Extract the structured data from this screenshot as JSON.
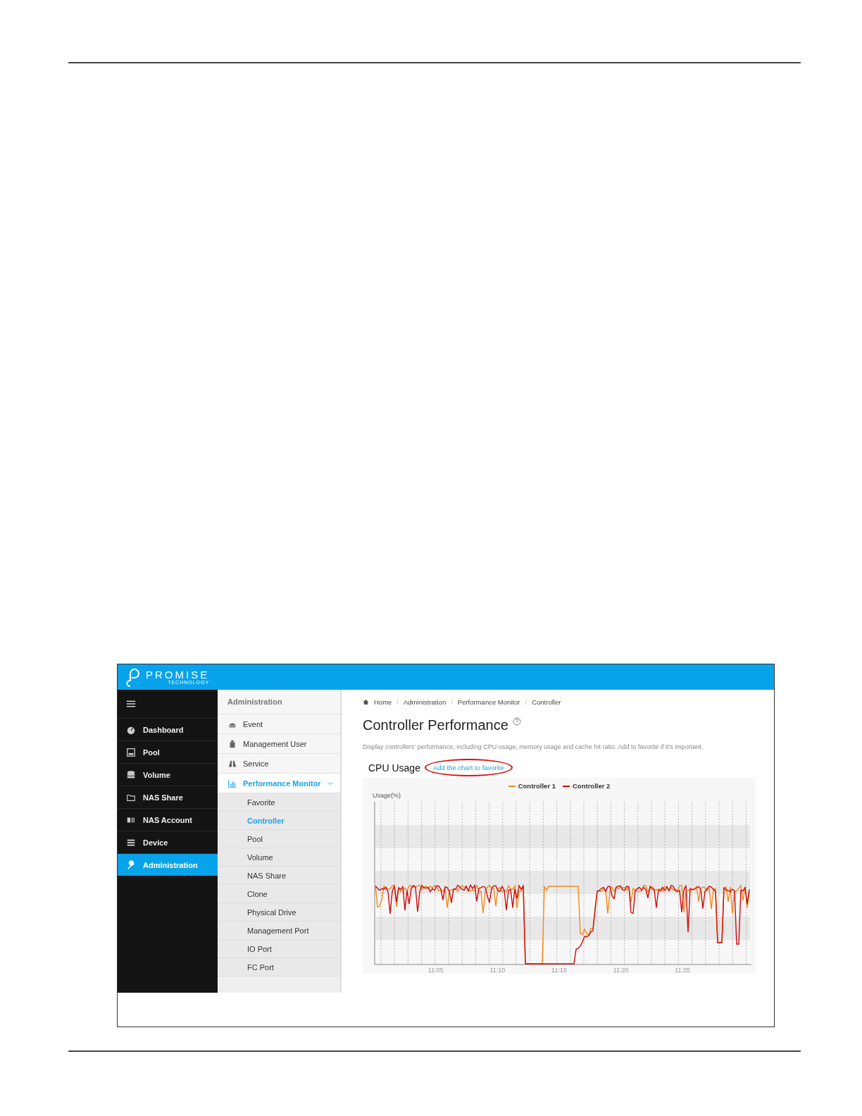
{
  "header": {
    "logo_text": "PROMISE",
    "logo_subtext": "TECHNOLOGY"
  },
  "sidebar": {
    "items": [
      {
        "label": "Dashboard",
        "selected": false
      },
      {
        "label": "Pool",
        "selected": false
      },
      {
        "label": "Volume",
        "selected": false
      },
      {
        "label": "NAS Share",
        "selected": false
      },
      {
        "label": "NAS Account",
        "selected": false
      },
      {
        "label": "Device",
        "selected": false
      },
      {
        "label": "Administration",
        "selected": true
      }
    ]
  },
  "submenu": {
    "title": "Administration",
    "items": [
      {
        "label": "Event",
        "expanded": false
      },
      {
        "label": "Management User",
        "expanded": false
      },
      {
        "label": "Service",
        "expanded": false
      },
      {
        "label": "Performance Monitor",
        "expanded": true,
        "children": [
          {
            "label": "Favorite",
            "selected": false
          },
          {
            "label": "Controller",
            "selected": true
          },
          {
            "label": "Pool",
            "selected": false
          },
          {
            "label": "Volume",
            "selected": false
          },
          {
            "label": "NAS Share",
            "selected": false
          },
          {
            "label": "Clone",
            "selected": false
          },
          {
            "label": "Physical Drive",
            "selected": false
          },
          {
            "label": "Management Port",
            "selected": false
          },
          {
            "label": "IO Port",
            "selected": false
          },
          {
            "label": "FC Port",
            "selected": false
          }
        ]
      }
    ]
  },
  "main": {
    "breadcrumb": [
      "Home",
      "Administration",
      "Performance Monitor",
      "Controller"
    ],
    "breadcrumb_separators": [
      "/",
      "/",
      "/"
    ],
    "title": "Controller Performance",
    "description": "Display controllers' performance, including CPU usage, memory usage and cache hit ratio. Add to favorite if it's important.",
    "section_title": "CPU Usage",
    "favorite_link": {
      "label": "Add the chart to favorite",
      "highlighted": true
    },
    "chart": {
      "legend": [
        {
          "name": "Controller 1",
          "color": "#f08a1c"
        },
        {
          "name": "Controller 2",
          "color": "#d10a0a"
        }
      ],
      "y_label": "Usage(%)",
      "x_labels": [
        "11:05",
        "11:10",
        "11:15",
        "11:20",
        "11:25"
      ]
    }
  }
}
